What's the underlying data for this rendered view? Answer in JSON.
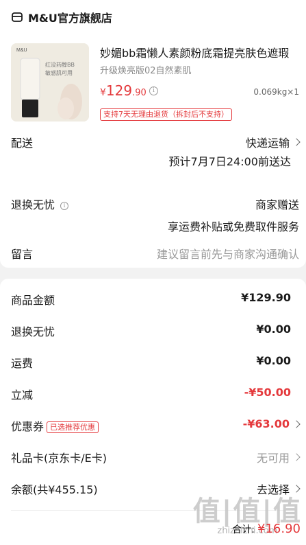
{
  "store": {
    "name": "M&U官方旗舰店",
    "icon": "store-icon"
  },
  "product": {
    "title": "妙媚bb霜懒人素颜粉底霜提亮肤色遮瑕",
    "spec": "升级焕亮版02自然素肌",
    "price_currency": "¥",
    "price_int": "129",
    "price_dec": ".90",
    "weight_qty": "0.069kg×1",
    "return_tag": "支持7天无理由退货（拆封后不支持）",
    "thumb_brand": "M&U",
    "thumb_text_1": "红没药醇BB",
    "thumb_text_2": "敏感肌可用"
  },
  "delivery": {
    "label": "配送",
    "method": "快递运输",
    "eta": "预计7月7日24:00前送达"
  },
  "return_worry": {
    "label": "退换无忧",
    "value": "商家赠送",
    "desc": "享运费补贴或免费取件服务"
  },
  "message": {
    "label": "留言",
    "placeholder": "建议留言前先与商家沟通确认"
  },
  "summary": {
    "goods_amount_label": "商品金额",
    "goods_amount": "¥129.90",
    "return_label": "退换无忧",
    "return_amount": "¥0.00",
    "shipping_label": "运费",
    "shipping_amount": "¥0.00",
    "discount_label": "立减",
    "discount_amount": "-¥50.00",
    "coupon_label": "优惠券",
    "coupon_tag": "已选推荐优惠",
    "coupon_amount": "-¥63.00",
    "giftcard_label": "礼品卡(京东卡/E卡)",
    "giftcard_value": "无可用",
    "balance_label": "余额(共¥455.15)",
    "balance_value": "去选择"
  },
  "footer": {
    "total_label": "合计:",
    "total_amount": "¥16.90",
    "watermark_big": "值|值|值",
    "watermark_small": "zhizhizhi.com"
  },
  "colors": {
    "accent": "#e4393c",
    "muted": "#999999"
  }
}
